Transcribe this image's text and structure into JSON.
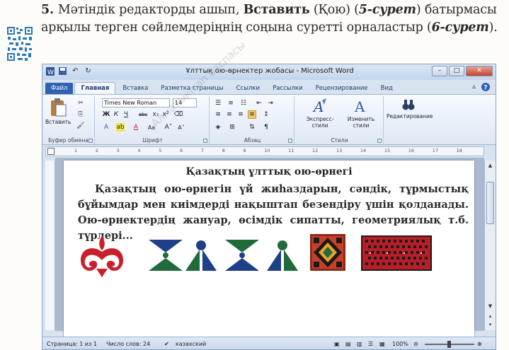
{
  "task": {
    "number": "5.",
    "text_1": "Мәтіндік редакторды ашып, ",
    "bold_1": "Вставить",
    "text_2": " (Қою) (",
    "ref_1": "5-сурет",
    "text_3": ") батырмасы арқылы терген сөйлемдеріңнің соңына суретті орналастыр (",
    "ref_2": "6-сурет",
    "text_4": ")."
  },
  "window": {
    "title": "Ұлттық ою-өрнектер жобасы - Microsoft Word"
  },
  "tabs": [
    "Файл",
    "Главная",
    "Вставка",
    "Разметка страницы",
    "Ссылки",
    "Рассылки",
    "Рецензирование",
    "Вид"
  ],
  "ribbon": {
    "paste_label": "Вставить",
    "clipboard_label": "Буфер обмена",
    "font_name": "Times New Roman",
    "font_size": "14",
    "font_group_label": "Шрифт",
    "paragraph_label": "Абзац",
    "styles_label": "Стили",
    "express_styles": "Экспресс-стили",
    "change_styles": "Изменить стили",
    "editing_label": "Редактирование"
  },
  "ruler": {
    "numbers": [
      "1",
      "2",
      "3",
      "4",
      "5",
      "6",
      "7",
      "8",
      "9",
      "10",
      "11",
      "12",
      "13",
      "14",
      "15",
      "16",
      "17",
      "18"
    ]
  },
  "document": {
    "heading": "Қазақтың ұлттық ою-өрнегі",
    "paragraph": "Қазақтың ою-өрнегін үй жиһаздарын, сәндік, тұрмыстық бұйымдар мен киімдерді нақыштап безендіру үшін қолданады. Ою-өрнектердің жануар, өсімдік сипатты, геометриялық т.б. түрлері..."
  },
  "status": {
    "page": "Страница: 1 из 1",
    "words": "Число слов: 24",
    "language": "казахский",
    "zoom": "100%"
  },
  "watermark": "Алматыкітап баспасы",
  "colors": {
    "ornament_red": "#c8202a",
    "ornament_navy": "#1e3f8a",
    "ornament_green": "#1f6b3a"
  }
}
